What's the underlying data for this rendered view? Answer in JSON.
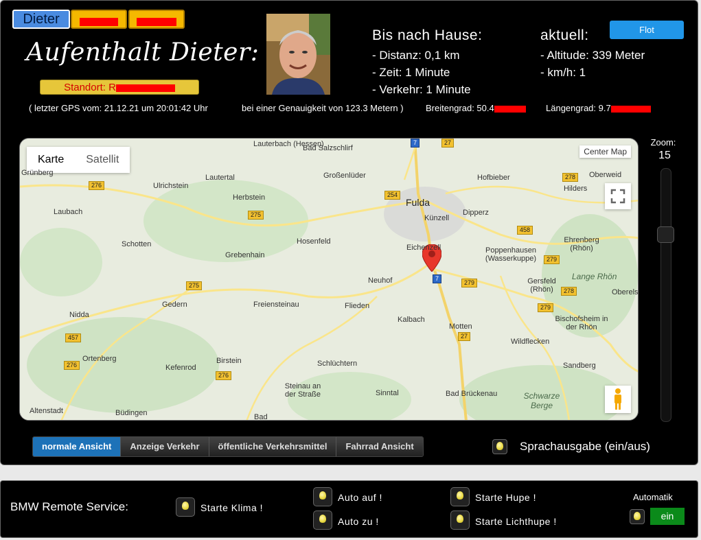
{
  "tabs": [
    {
      "label": "Dieter",
      "active": true
    },
    {
      "label": "",
      "redacted": true
    },
    {
      "label": "",
      "redacted": true
    }
  ],
  "title": "Aufenthalt Dieter:",
  "standort_label": "Standort: R",
  "home": {
    "heading": "Bis nach Hause:",
    "distance": "- Distanz: 0,1 km",
    "time": "- Zeit: 1 Minute",
    "traffic": "- Verkehr: 1 Minute"
  },
  "current": {
    "heading": "aktuell:",
    "altitude": "- Altitude: 339 Meter",
    "speed": "- km/h: 1"
  },
  "flot_button": "Flot",
  "gps": {
    "last": "( letzter GPS vom: 21.12.21 um 20:01:42 Uhr",
    "accuracy": "bei einer Genauigkeit von 123.3 Metern )",
    "lat": "Breitengrad: 50.4",
    "lon": "Längengrad: 9.7"
  },
  "map": {
    "type_buttons": [
      "Karte",
      "Satellit"
    ],
    "center_button": "Center Map",
    "places": [
      "Lauterbach (Hessen)",
      "Bad Salzschlirf",
      "Grünberg",
      "Ulrichstein",
      "Lautertal",
      "Großenlüder",
      "Hofbieber",
      "Oberweid",
      "Hilders",
      "Laubach",
      "Herbstein",
      "Fulda",
      "Dipperz",
      "Künzell",
      "Schotten",
      "Hosenfeld",
      "Grebenhain",
      "Eichenzell",
      "Poppenhausen (Wasserkuppe)",
      "Ehrenberg (Rhön)",
      "Lange Rhön",
      "Gedern",
      "Neuhof",
      "Gersfeld (Rhön)",
      "Oberelsbach",
      "Nidda",
      "Freiensteinau",
      "Flieden",
      "Kalbach",
      "Motten",
      "Bischofsheim in der Rhön",
      "Wildflecken",
      "Ortenberg",
      "Kefenrod",
      "Birstein",
      "Schlüchtern",
      "Sandberg",
      "Steinau an der Straße",
      "Sinntal",
      "Bad Brückenau",
      "Schwarze Berge",
      "Altenstadt",
      "Büdingen",
      "Bad"
    ],
    "road_shields": [
      "276",
      "275",
      "275",
      "254",
      "27",
      "7",
      "458",
      "278",
      "279",
      "278",
      "279",
      "27",
      "7",
      "457",
      "276",
      "276",
      "279"
    ]
  },
  "zoom": {
    "label": "Zoom:",
    "value": "15"
  },
  "view_buttons": [
    "normale Ansicht",
    "Anzeige Verkehr",
    "öffentliche Verkehrsmittel",
    "Fahrrad Ansicht"
  ],
  "speech_label": "Sprachausgabe (ein/aus)",
  "bmw": {
    "heading": "BMW Remote Service:",
    "klima": "Starte Klima !",
    "auf": "Auto auf !",
    "zu": "Auto zu !",
    "hupe": "Starte Hupe !",
    "lichthupe": "Starte Lichthupe !",
    "auto_label": "Automatik",
    "auto_value": "ein"
  },
  "colors": {
    "accent_blue": "#1d72b8",
    "tab_yellow": "#f5b800",
    "redaction": "#ff0000",
    "ein_green": "#0b8a1a"
  }
}
